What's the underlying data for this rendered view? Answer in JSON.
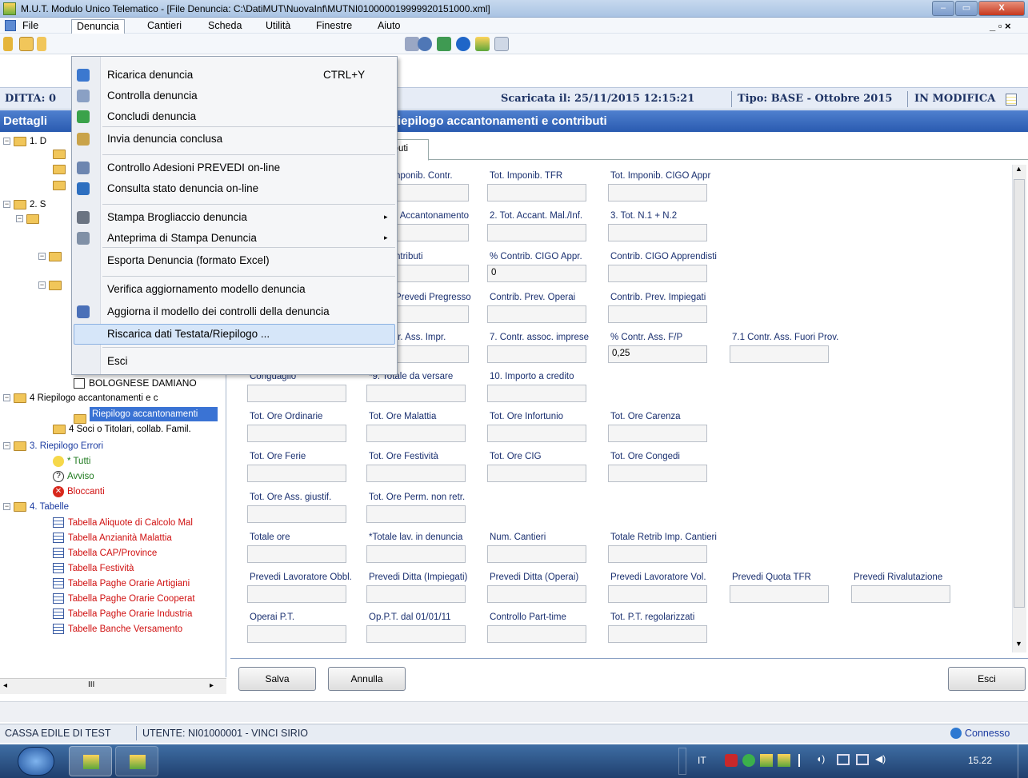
{
  "window": {
    "title": "M.U.T. Modulo Unico Telematico - [File Denuncia: C:\\DatiMUT\\NuovaInf\\MUTNI010000019999920151000.xml]",
    "min_label": "–",
    "max_label": "▭",
    "close_label": "X"
  },
  "menubar": {
    "items": [
      "File",
      "Denuncia",
      "Cantieri",
      "Scheda",
      "Utilità",
      "Finestre",
      "Aiuto"
    ],
    "mdi_controls": "_ ▫ ×"
  },
  "infobar": {
    "ditta": "DITTA: 0",
    "scaricata": "Scaricata il: 25/11/2015 12:15:21",
    "tipo": "Tipo: BASE - Ottobre 2015",
    "stato": "IN MODIFICA"
  },
  "header": {
    "left": "Dettagli",
    "right": "iepilogo accantonamenti e contributi"
  },
  "tab": {
    "label": "ibuti"
  },
  "tree": {
    "items": [
      {
        "text": "1. D",
        "color": "#000"
      },
      {
        "text": "2. S",
        "color": "#000"
      },
      {
        "text": "BOLOGNESE DAMIANO",
        "color": "#000"
      },
      {
        "text": "4 Riepilogo accantonamenti e c",
        "color": "#000"
      },
      {
        "text": "Riepilogo accantonamenti",
        "color": "#fff"
      },
      {
        "text": "4 Soci o Titolari, collab. Famil.",
        "color": "#000"
      },
      {
        "text": "3. Riepilogo Errori",
        "color": "#1a3aa0"
      },
      {
        "text": "* Tutti",
        "color": "#1f7a1f"
      },
      {
        "text": "Avviso",
        "color": "#1f7a1f"
      },
      {
        "text": "Bloccanti",
        "color": "#d01010"
      },
      {
        "text": "4. Tabelle",
        "color": "#1a3aa0"
      },
      {
        "text": "Tabella Aliquote di Calcolo Mal",
        "color": "#d01010"
      },
      {
        "text": "Tabella Anzianità Malattia",
        "color": "#d01010"
      },
      {
        "text": "Tabella CAP/Province",
        "color": "#d01010"
      },
      {
        "text": "Tabella Festività",
        "color": "#d01010"
      },
      {
        "text": "Tabella Paghe Orarie Artigiani",
        "color": "#d01010"
      },
      {
        "text": "Tabella Paghe Orarie Cooperat",
        "color": "#d01010"
      },
      {
        "text": "Tabella Paghe Orarie Industria",
        "color": "#d01010"
      },
      {
        "text": "Tabelle Banche Versamento",
        "color": "#d01010"
      }
    ],
    "scroll_mark": "III"
  },
  "form": {
    "fields": [
      {
        "label": "nponib. Contr.",
        "value": ""
      },
      {
        "label": "Tot. Imponib. TFR",
        "value": ""
      },
      {
        "label": "Tot. Imponib. CIGO Appr",
        "value": ""
      },
      {
        "label": ". Accantonamento",
        "value": ""
      },
      {
        "label": "2. Tot. Accant. Mal./Inf.",
        "value": ""
      },
      {
        "label": "3. Tot. N.1 + N.2",
        "value": ""
      },
      {
        "label": "ntributi",
        "value": ""
      },
      {
        "label": "% Contrib. CIGO Appr.",
        "value": "0"
      },
      {
        "label": "Contrib. CIGO Apprendisti",
        "value": ""
      },
      {
        "label": "Prevedi Pregresso",
        "value": ""
      },
      {
        "label": "Contrib. Prev. Operai",
        "value": ""
      },
      {
        "label": "Contrib. Prev. Impiegati",
        "value": ""
      },
      {
        "label": "tr. Ass. Impr.",
        "value": ""
      },
      {
        "label": "7. Contr. assoc. imprese",
        "value": ""
      },
      {
        "label": "% Contr. Ass. F/P",
        "value": "0,25"
      },
      {
        "label": "7.1 Contr. Ass. Fuori Prov.",
        "value": ""
      },
      {
        "label": "Conguaglio",
        "value": ""
      },
      {
        "label": "*9. Totale da versare",
        "value": ""
      },
      {
        "label": "10. Importo a credito",
        "value": ""
      },
      {
        "label": "Tot. Ore Ordinarie",
        "value": ""
      },
      {
        "label": "Tot. Ore Malattia",
        "value": ""
      },
      {
        "label": "Tot. Ore Infortunio",
        "value": ""
      },
      {
        "label": "Tot. Ore Carenza",
        "value": ""
      },
      {
        "label": "Tot. Ore Ferie",
        "value": ""
      },
      {
        "label": "Tot. Ore Festività",
        "value": ""
      },
      {
        "label": "Tot. Ore CIG",
        "value": ""
      },
      {
        "label": "Tot. Ore Congedi",
        "value": ""
      },
      {
        "label": "Tot. Ore Ass. giustif.",
        "value": ""
      },
      {
        "label": "Tot. Ore Perm. non retr.",
        "value": ""
      },
      {
        "label": "Totale ore",
        "value": ""
      },
      {
        "label": "*Totale lav. in denuncia",
        "value": ""
      },
      {
        "label": "Num. Cantieri",
        "value": ""
      },
      {
        "label": "Totale Retrib Imp. Cantieri",
        "value": ""
      },
      {
        "label": "Prevedi Lavoratore Obbl.",
        "value": ""
      },
      {
        "label": "Prevedi Ditta (Impiegati)",
        "value": ""
      },
      {
        "label": "Prevedi Ditta (Operai)",
        "value": ""
      },
      {
        "label": "Prevedi Lavoratore Vol.",
        "value": ""
      },
      {
        "label": "Prevedi Quota TFR",
        "value": ""
      },
      {
        "label": "Prevedi Rivalutazione",
        "value": ""
      },
      {
        "label": "Operai P.T.",
        "value": ""
      },
      {
        "label": "Op.P.T. dal 01/01/11",
        "value": ""
      },
      {
        "label": "Controllo Part-time",
        "value": ""
      },
      {
        "label": "Tot. P.T. regolarizzati",
        "value": ""
      }
    ],
    "buttons": {
      "save": "Salva",
      "cancel": "Annulla",
      "exit": "Esci"
    }
  },
  "dropdown": {
    "items": [
      {
        "label": "Ricarica denuncia",
        "shortcut": "CTRL+Y",
        "icon": "reload-icon"
      },
      {
        "label": "Controlla denuncia",
        "shortcut": "",
        "icon": "check-magnifier-icon"
      },
      {
        "label": "Concludi denuncia",
        "shortcut": "",
        "icon": "checkmark-icon"
      },
      {
        "label": "Invia denuncia conclusa",
        "shortcut": "",
        "icon": "send-icon"
      },
      {
        "label": "Controllo Adesioni PREVEDI on-line",
        "shortcut": "",
        "icon": "chart-icon"
      },
      {
        "label": "Consulta stato denuncia on-line",
        "shortcut": "",
        "icon": "globe-search-icon"
      },
      {
        "label": "Stampa Brogliaccio denuncia",
        "shortcut": "",
        "icon": "printer-icon"
      },
      {
        "label": "Anteprima di Stampa Denuncia",
        "shortcut": "",
        "icon": "print-preview-icon"
      },
      {
        "label": "Esporta Denuncia (formato Excel)",
        "shortcut": "",
        "icon": ""
      },
      {
        "label": "Verifica aggiornamento modello denuncia",
        "shortcut": "",
        "icon": ""
      },
      {
        "label": "Aggiorna il modello dei controlli della denuncia",
        "shortcut": "",
        "icon": "update-icon"
      },
      {
        "label": "Riscarica dati Testata/Riepilogo ...",
        "shortcut": "",
        "icon": ""
      },
      {
        "label": "Esci",
        "shortcut": "",
        "icon": ""
      }
    ],
    "submenu_arrow": "▸"
  },
  "statusbar": {
    "cassa": "CASSA EDILE DI TEST",
    "utente": "UTENTE: NI01000001 - VINCI SIRIO",
    "connection": "Connesso"
  },
  "taskbar": {
    "lang": "IT",
    "clock": "15.22"
  },
  "colors": {
    "header_blue": "#2f63b8",
    "selection": "#cde1f7",
    "tree_red": "#d01010"
  }
}
